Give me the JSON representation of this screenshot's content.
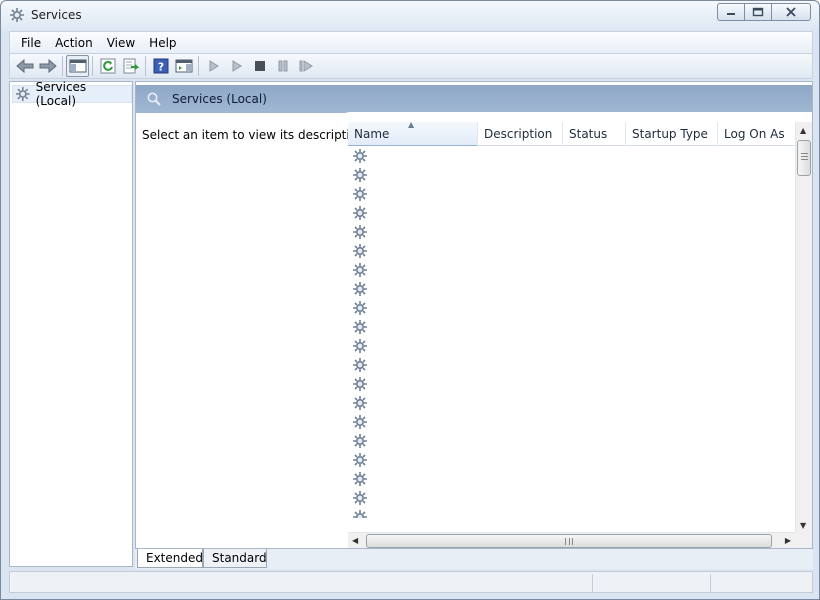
{
  "window": {
    "title": "Services"
  },
  "menu": [
    "File",
    "Action",
    "View",
    "Help"
  ],
  "toolbar": {
    "buttons": [
      "back-icon",
      "forward-icon",
      "show-hide-console-tree-icon",
      "refresh-icon",
      "export-list-icon",
      "help-icon",
      "show-action-pane-icon",
      "start-service-icon",
      "start-service-alt-icon",
      "stop-service-icon",
      "pause-service-icon",
      "restart-service-icon"
    ]
  },
  "tree": {
    "root_label": "Services (Local)"
  },
  "content": {
    "header_title": "Services (Local)",
    "description_prompt": "Select an item to view its description.",
    "columns": [
      "Name",
      "Description",
      "Status",
      "Startup Type",
      "Log On As"
    ],
    "sorted_column": "Name",
    "visible_service_rows": 20
  },
  "tabs": [
    "Extended",
    "Standard"
  ],
  "active_tab": "Extended",
  "colors": {
    "header_band": "#98b0cd",
    "window_frame": "#dbe5f1",
    "accent": "#3a6ea5"
  }
}
